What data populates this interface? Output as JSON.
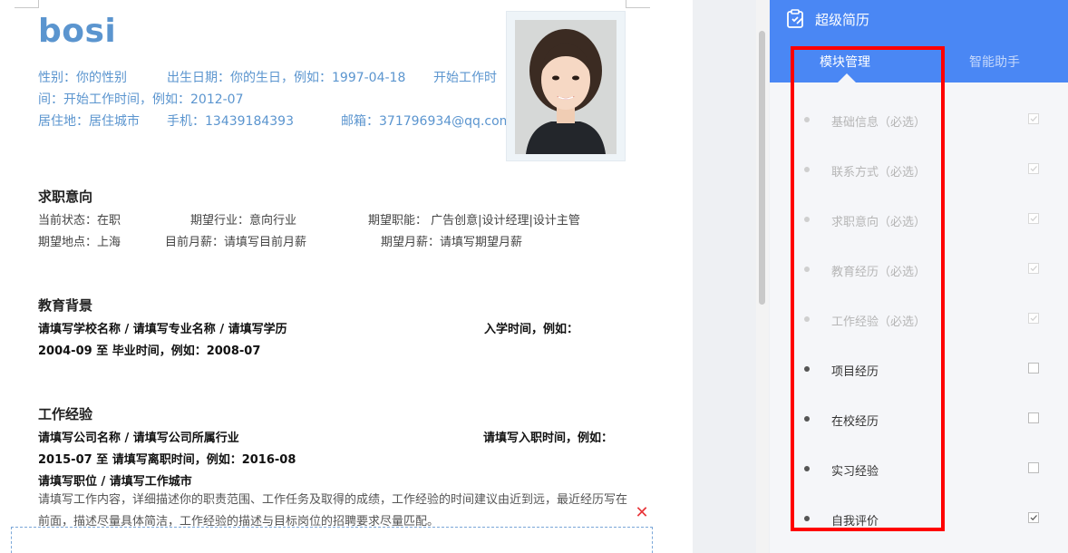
{
  "resume": {
    "name": "bosi",
    "info": {
      "line1_gender": "性别：你的性别",
      "line1_birth": "出生日期：你的生日，例如：1997-04-18",
      "line1_work_a": "开始工作时",
      "line2": "间：开始工作时间，例如：2012-07",
      "line3_city": "居住地：居住城市",
      "line3_phone": "手机：13439184393",
      "line3_email": "邮箱：371796934@qq.com"
    },
    "intent": {
      "title": "求职意向",
      "status": "当前状态：在职",
      "industry": "期望行业：意向行业",
      "function": "期望职能： 广告创意|设计经理|设计主管",
      "location": "期望地点：上海",
      "current_salary": "目前月薪：请填写目前月薪",
      "expected_salary": "期望月薪：请填写期望月薪"
    },
    "education": {
      "title": "教育背景",
      "line1": "请填写学校名称 / 请填写专业名称 / 请填写学历",
      "start_label": "入学时间，例如：",
      "line2": "2004-09  至  毕业时间，例如：2008-07"
    },
    "work": {
      "title": "工作经验",
      "line1": "请填写公司名称 / 请填写公司所属行业",
      "start_label": "请填写入职时间，例如：",
      "line2": "2015-07  至  请填写离职时间，例如：2016-08",
      "line3": "请填写职位 / 请填写工作城市",
      "description": "请填写工作内容，详细描述你的职责范围、工作任务及取得的成绩，工作经验的时间建议由近到远，最近经历写在前面，描述尽量具体简洁，工作经验的描述与目标岗位的招聘要求尽量匹配。"
    },
    "close_glyph": "✕"
  },
  "panel": {
    "title": "超级简历",
    "tabs": [
      {
        "label": "模块管理",
        "active": true
      },
      {
        "label": "智能助手",
        "active": false
      }
    ],
    "modules": [
      {
        "label": "基础信息（必选）",
        "checked": true,
        "required": true
      },
      {
        "label": "联系方式（必选）",
        "checked": true,
        "required": true
      },
      {
        "label": "求职意向（必选）",
        "checked": true,
        "required": true
      },
      {
        "label": "教育经历（必选）",
        "checked": true,
        "required": true
      },
      {
        "label": "工作经验（必选）",
        "checked": true,
        "required": true
      },
      {
        "label": "项目经历",
        "checked": false,
        "required": false
      },
      {
        "label": "在校经历",
        "checked": false,
        "required": false
      },
      {
        "label": "实习经验",
        "checked": false,
        "required": false
      },
      {
        "label": "自我评价",
        "checked": true,
        "required": false
      }
    ]
  },
  "colors": {
    "accent_blue": "#4a87f4",
    "name_blue": "#5b95cf",
    "highlight_red": "#ff0000"
  }
}
